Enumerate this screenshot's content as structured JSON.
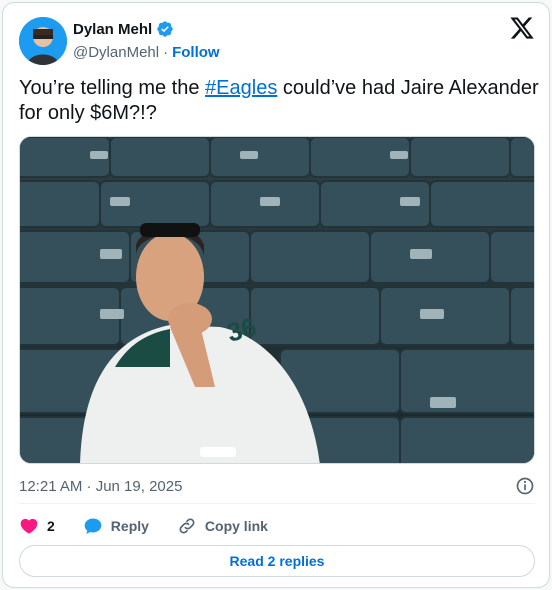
{
  "author": {
    "display_name": "Dylan Mehl",
    "handle": "@DylanMehl",
    "separator": "·",
    "follow_label": "Follow",
    "verified_icon": "verified-badge-icon"
  },
  "tweet": {
    "text_before": "You’re telling me the ",
    "hashtag": "#Eagles",
    "text_after": " could’ve had Jaire Alexander for only $6M?!?",
    "media_description_icon": "photo-image"
  },
  "meta": {
    "timestamp": "12:21 AM · Jun 19, 2025",
    "info_icon": "info-icon"
  },
  "actions": {
    "like_count": "2",
    "reply_label": "Reply",
    "copy_link_label": "Copy link"
  },
  "footer": {
    "read_replies_label": "Read 2 replies"
  },
  "colors": {
    "link": "#006fd6",
    "like": "#f91880",
    "verified": "#1d9bf0",
    "muted": "#536471"
  }
}
